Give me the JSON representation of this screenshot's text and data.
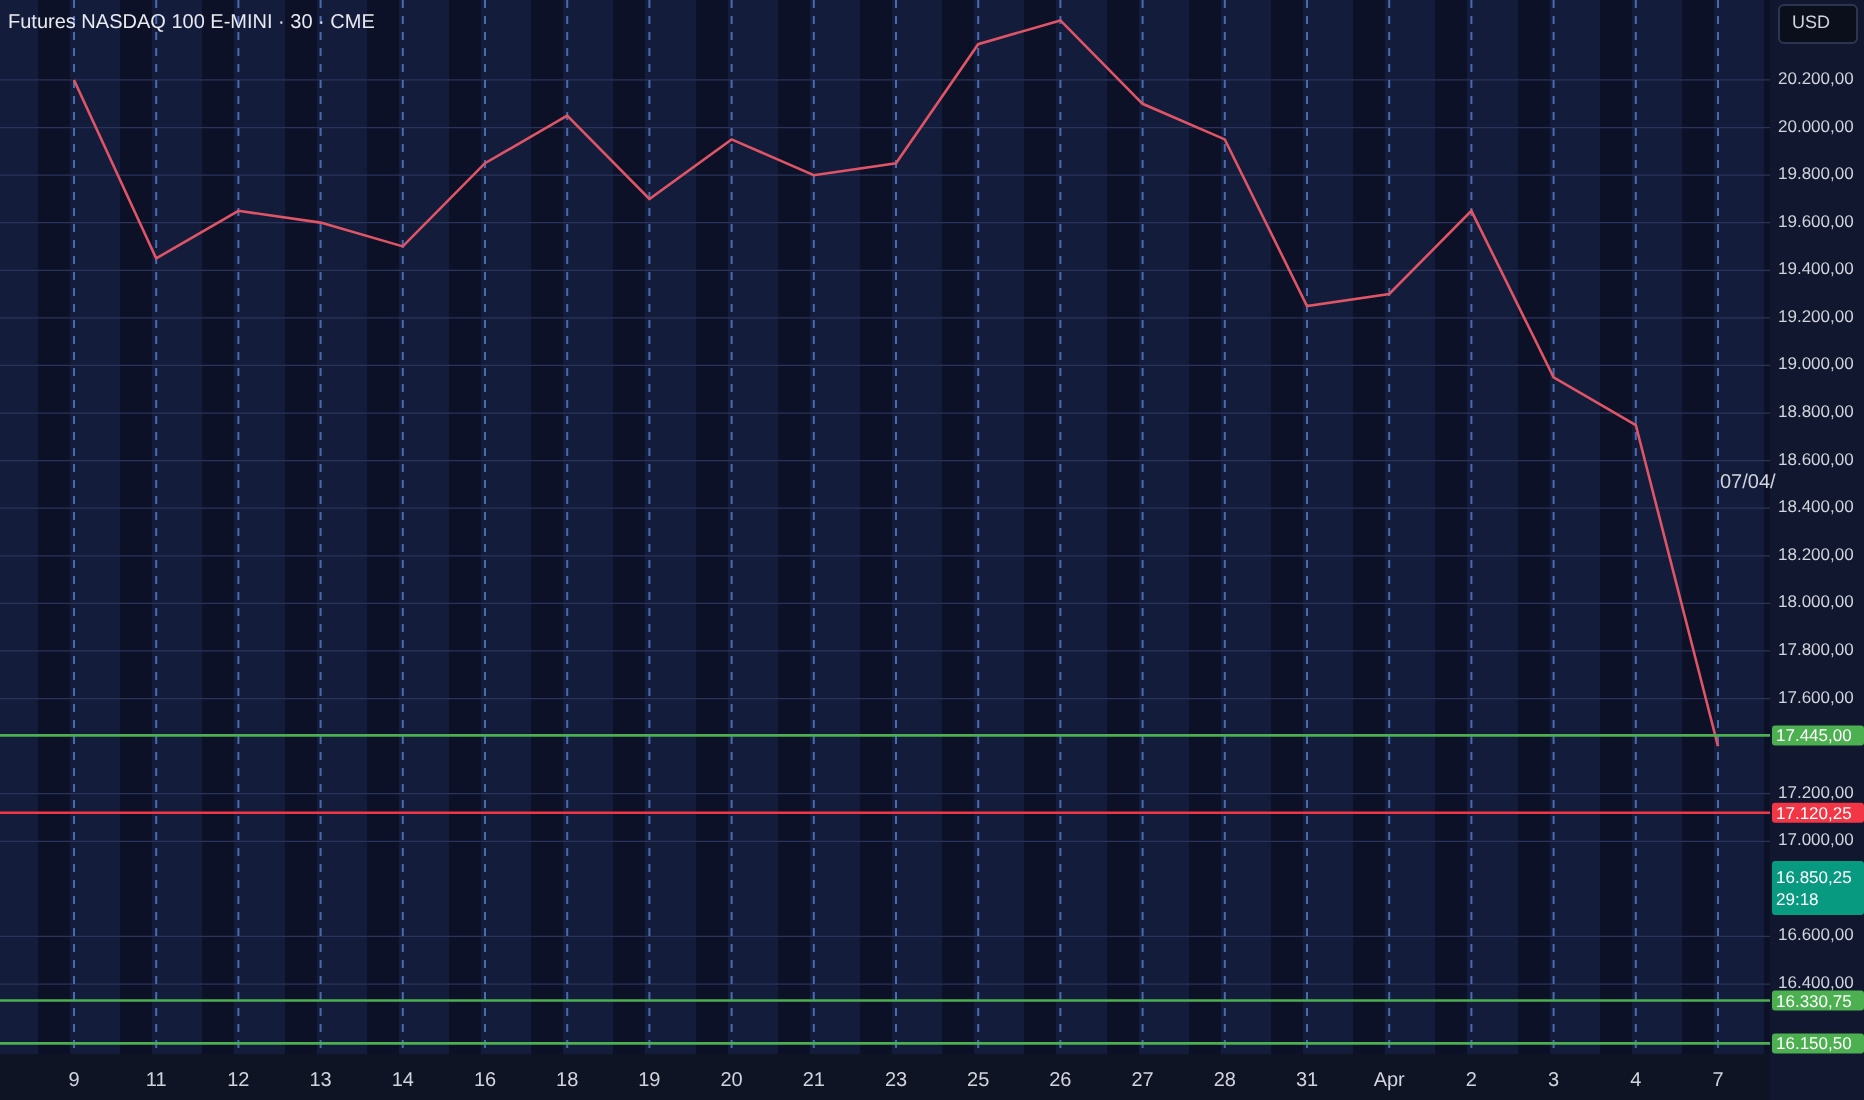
{
  "title": "Futures NASDAQ 100 E-MINI · 30 · CME",
  "currency_button": "USD",
  "chart_data": {
    "type": "line",
    "categories": [
      "9",
      "11",
      "12",
      "13",
      "14",
      "16",
      "18",
      "19",
      "20",
      "21",
      "23",
      "25",
      "26",
      "27",
      "28",
      "31",
      "Apr",
      "2",
      "3",
      "4",
      "7"
    ],
    "series": [
      {
        "color": "#e05565",
        "values": [
          20200,
          19450,
          19650,
          19600,
          19500,
          19850,
          20050,
          19700,
          19950,
          19800,
          19850,
          20350,
          20450,
          20100,
          19950,
          19250,
          19300,
          19650,
          18950,
          18750,
          17400
        ]
      }
    ],
    "ylim": [
      16106,
      20536
    ],
    "grid": true,
    "yticks": [
      {
        "value": 20200,
        "label": "20.200,00"
      },
      {
        "value": 20000,
        "label": "20.000,00"
      },
      {
        "value": 19800,
        "label": "19.800,00"
      },
      {
        "value": 19600,
        "label": "19.600,00"
      },
      {
        "value": 19400,
        "label": "19.400,00"
      },
      {
        "value": 19200,
        "label": "19.200,00"
      },
      {
        "value": 19000,
        "label": "19.000,00"
      },
      {
        "value": 18800,
        "label": "18.800,00"
      },
      {
        "value": 18600,
        "label": "18.600,00"
      },
      {
        "value": 18400,
        "label": "18.400,00"
      },
      {
        "value": 18200,
        "label": "18.200,00"
      },
      {
        "value": 18000,
        "label": "18.000,00"
      },
      {
        "value": 17800,
        "label": "17.800,00"
      },
      {
        "value": 17600,
        "label": "17.600,00"
      },
      {
        "value": 17200,
        "label": "17.200,00"
      },
      {
        "value": 17000,
        "label": "17.000,00"
      },
      {
        "value": 16600,
        "label": "16.600,00"
      },
      {
        "value": 16400,
        "label": "16.400,00"
      }
    ],
    "ref_lines": [
      {
        "axis": "y",
        "value": 17445,
        "label": "17.445,00",
        "color": "#4caf50"
      },
      {
        "axis": "y",
        "value": 17120.25,
        "label": "17.120,25",
        "color": "#f23645"
      },
      {
        "axis": "y",
        "value": 16330.75,
        "label": "16.330,75",
        "color": "#4caf50"
      },
      {
        "axis": "y",
        "value": 16150.5,
        "label": "16.150,50",
        "color": "#4caf50"
      }
    ]
  },
  "current_price": {
    "price": "16.850,25",
    "countdown": "29:18"
  },
  "cursor_date": "07/04/"
}
